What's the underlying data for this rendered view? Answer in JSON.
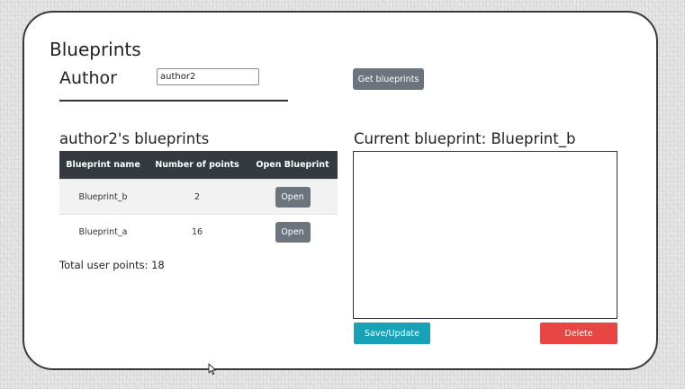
{
  "header": {
    "title": "Blueprints",
    "author_label": "Author",
    "author_value": "author2",
    "get_button": "Get blueprints"
  },
  "list": {
    "title": "author2's blueprints",
    "columns": [
      "Blueprint name",
      "Number of points",
      "Open Blueprint"
    ],
    "rows": [
      {
        "name": "Blueprint_b",
        "points": "2",
        "action": "Open"
      },
      {
        "name": "Blueprint_a",
        "points": "16",
        "action": "Open"
      }
    ],
    "total": "Total user points: 18"
  },
  "current": {
    "title": "Current blueprint: Blueprint_b",
    "save_button": "Save/Update",
    "delete_button": "Delete"
  },
  "colors": {
    "table_header": "#343a40",
    "secondary_button": "#6c757d",
    "save_button": "#17a2b8",
    "delete_button": "#e84545"
  },
  "icons": {
    "cursor": "mouse-pointer-icon"
  }
}
